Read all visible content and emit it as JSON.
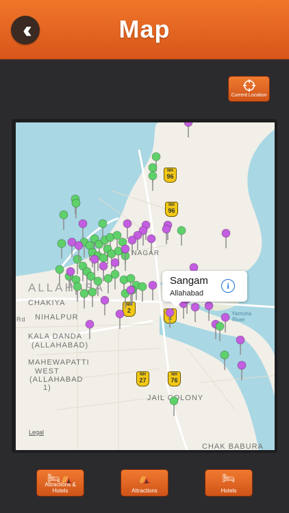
{
  "header": {
    "title": "Map",
    "back_icon": "chevrons-left-icon"
  },
  "current_location_label": "Current Location",
  "map": {
    "labels": {
      "allahabad": "ALLAHABA",
      "chakiya": "CHAKIYA",
      "nihalpur": "NIHALPUR",
      "kala_danda": "KALA DANDA",
      "kala_danda_sub": "(ALLAHABAD)",
      "mahewapatti": "MAHEWAPATTI",
      "west": "WEST",
      "allahabad1": "(ALLAHABAD",
      "one": "1)",
      "jail_colony": "JAIL COLONY",
      "chak_babura": "CHAK BABURA",
      "yamuna": "Yamuna",
      "river": "River",
      "nagar": "IT NAGAR",
      "rd": "Rd"
    },
    "shields": {
      "nh96": "96",
      "nh27": "27",
      "nh76": "76",
      "nh2": "2",
      "prefix": "NH"
    },
    "legal": "Legal",
    "callout": {
      "title": "Sangam",
      "subtitle": "Allahabad"
    }
  },
  "tabs": [
    {
      "label": "Attractions & Hotels",
      "icon": "bed-and-tent-icon"
    },
    {
      "label": "Attractions",
      "icon": "tent-icon"
    },
    {
      "label": "Hotels",
      "icon": "bed-icon"
    }
  ],
  "colors": {
    "accent": "#e8642a",
    "green_pin": "#5fd16a",
    "purple_pin": "#c35ee0",
    "water": "#a9d7e4",
    "land": "#f1efe8"
  }
}
